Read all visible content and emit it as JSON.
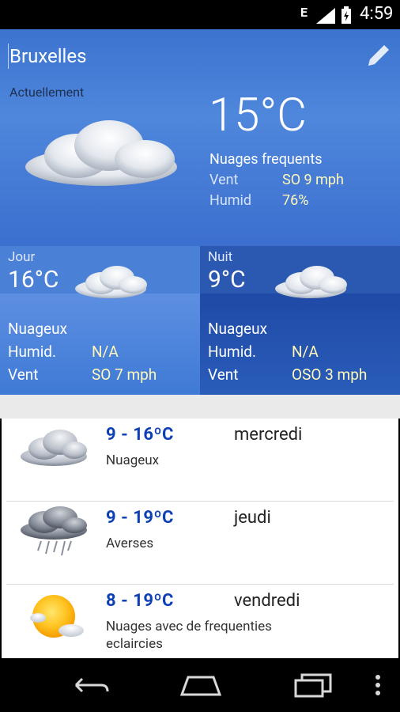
{
  "status_bar": {
    "network": "E",
    "time": "4:59",
    "icons": [
      "signal-icon",
      "battery-icon"
    ]
  },
  "header": {
    "city": "Bruxelles",
    "current_label": "Actuellement",
    "temperature": "15°C",
    "condition": "Nuages frequents",
    "wind_label": "Vent",
    "wind_value": "SO 9 mph",
    "humidity_label": "Humid",
    "humidity_value": "76%",
    "edit_icon": "pencil-icon"
  },
  "day_panel": {
    "title": "Jour",
    "temperature": "16°C",
    "condition": "Nuageux",
    "humidity_label": "Humid.",
    "humidity_value": "N/A",
    "wind_label": "Vent",
    "wind_value": "SO 7 mph"
  },
  "night_panel": {
    "title": "Nuit",
    "temperature": "9°C",
    "condition": "Nuageux",
    "humidity_label": "Humid.",
    "humidity_value": "N/A",
    "wind_label": "Vent",
    "wind_value": "OSO 3 mph"
  },
  "forecast": [
    {
      "range": "9 - 16ºC",
      "desc": "Nuageux",
      "day": "mercredi",
      "icon": "cloud-icon"
    },
    {
      "range": "9 - 19ºC",
      "desc": "Averses",
      "day": "jeudi",
      "icon": "rain-cloud-icon"
    },
    {
      "range": "8 - 19ºC",
      "desc": "Nuages avec de frequenties eclaircies",
      "day": "vendredi",
      "icon": "sun-cloud-icon"
    }
  ],
  "nav": [
    "back-icon",
    "home-icon",
    "recent-apps-icon",
    "overflow-menu-icon"
  ],
  "colors": {
    "header_blue": "#4a80d6",
    "range_blue": "#0d3fb5",
    "value_yellow": "#fff9b8"
  }
}
